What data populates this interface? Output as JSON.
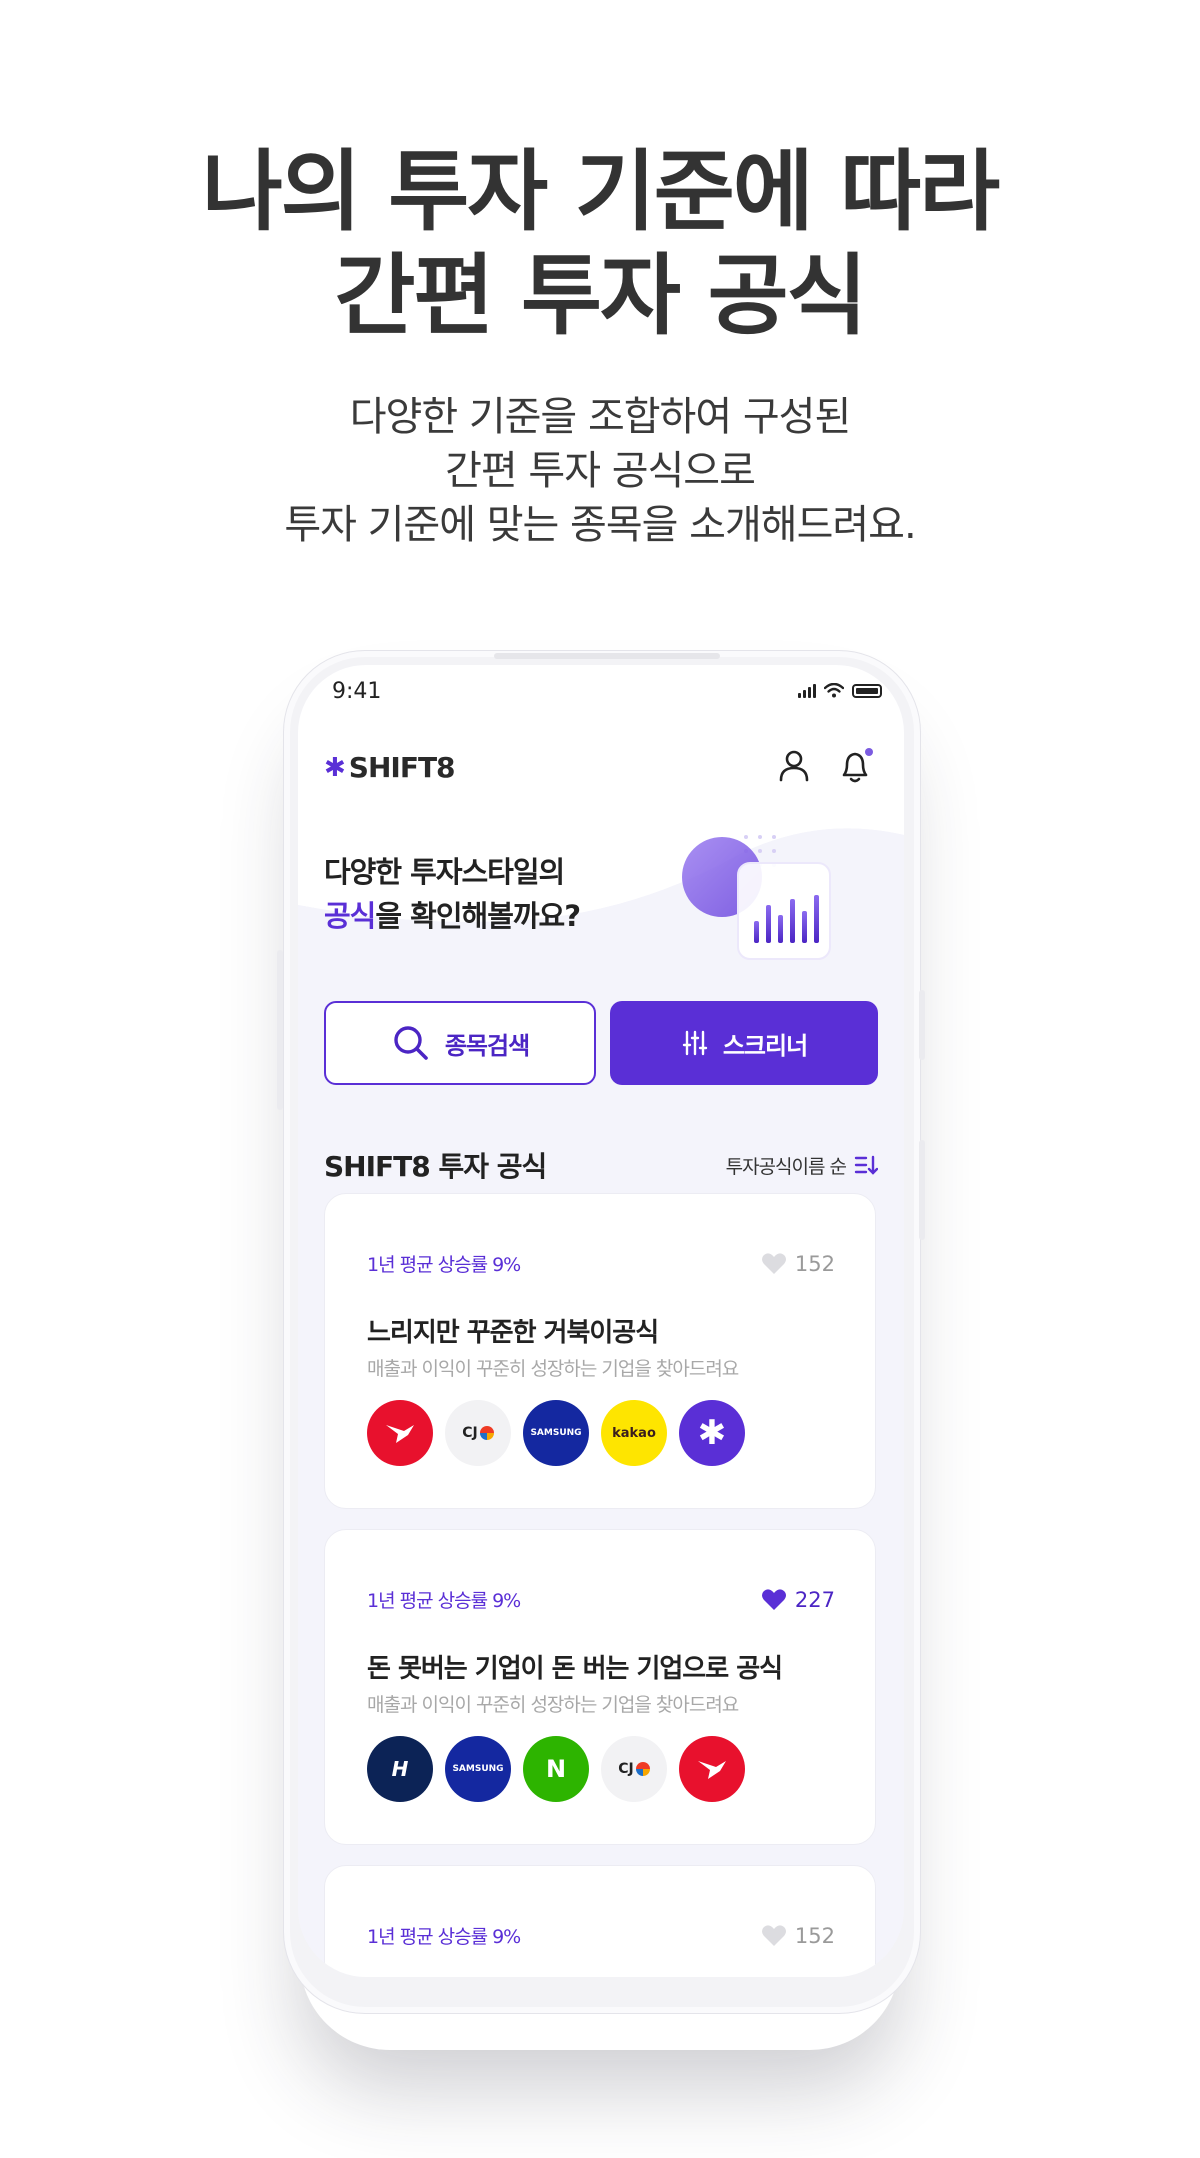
{
  "headline": {
    "line1": "나의 투자 기준에 따라",
    "line2": "간편 투자 공식"
  },
  "subcopy": {
    "line1": "다양한 기준을 조합하여 구성된",
    "line2": "간편 투자 공식으로",
    "line3": "투자 기준에 맞는 종목을 소개해드려요."
  },
  "status": {
    "time": "9:41"
  },
  "app": {
    "brand": "SHIFT8"
  },
  "hero": {
    "line1": "다양한 투자스타일의",
    "line2_accent": "공식",
    "line2_rest": "을 확인해볼까요?"
  },
  "buttons": {
    "search": "종목검색",
    "screener": "스크리너"
  },
  "section": {
    "title": "SHIFT8 투자 공식",
    "sort_label": "투자공식이름 순"
  },
  "cards": [
    {
      "rate": "1년 평균 상승률 9%",
      "likes": "152",
      "liked": false,
      "title": "느리지만 꾸준한 거북이공식",
      "desc": "매출과 이익이 꾸준히 성장하는 기업을 찾아드려요",
      "logos": [
        {
          "name": "red-company-logo",
          "text": "",
          "bg": "#e8112d"
        },
        {
          "name": "cj-logo",
          "text": "CJ",
          "bg": "#f2f2f4"
        },
        {
          "name": "samsung-logo",
          "text": "SAMSUNG",
          "bg": "#1428a0"
        },
        {
          "name": "kakao-logo",
          "text": "kakao",
          "bg": "#fee500"
        },
        {
          "name": "purple-asterisk-logo",
          "text": "✱",
          "bg": "#5a2fd6"
        }
      ]
    },
    {
      "rate": "1년 평균 상승률 9%",
      "likes": "227",
      "liked": true,
      "title": "돈 못버는 기업이 돈 버는 기업으로 공식",
      "desc": "매출과 이익이 꾸준히 성장하는 기업을 찾아드려요",
      "logos": [
        {
          "name": "hyundai-logo",
          "text": "H",
          "bg": "#0c2356"
        },
        {
          "name": "samsung-logo",
          "text": "SAMSUNG",
          "bg": "#1428a0"
        },
        {
          "name": "naver-logo",
          "text": "N",
          "bg": "#2db400"
        },
        {
          "name": "cj-logo",
          "text": "CJ",
          "bg": "#f2f2f4"
        },
        {
          "name": "red-company-logo",
          "text": "",
          "bg": "#e8112d"
        }
      ]
    },
    {
      "rate": "1년 평균 상승률 9%",
      "likes": "152",
      "liked": false
    }
  ],
  "colors": {
    "accent": "#5a2fd6",
    "muted": "#a8a8a8",
    "screen_bg": "#f4f4fb"
  }
}
